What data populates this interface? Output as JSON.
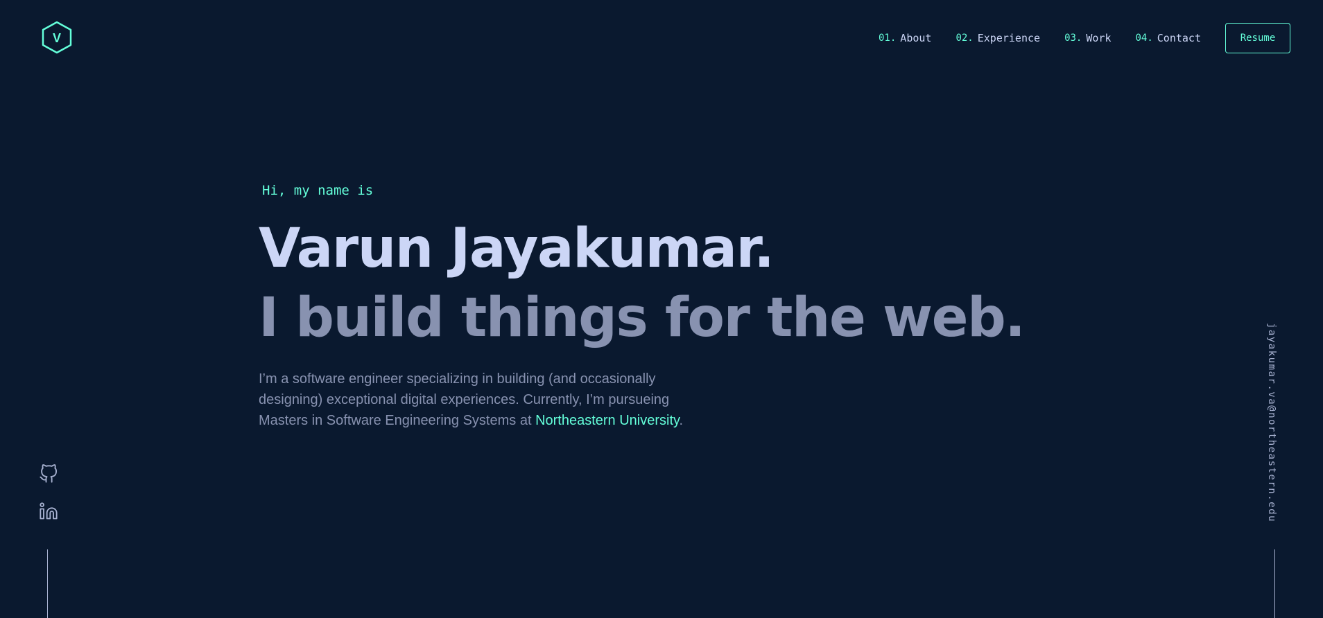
{
  "logo": {
    "letter": "V",
    "icon": "hexagon-logo-icon"
  },
  "nav": {
    "items": [
      {
        "num": "01.",
        "label": "About"
      },
      {
        "num": "02.",
        "label": "Experience"
      },
      {
        "num": "03.",
        "label": "Work"
      },
      {
        "num": "04.",
        "label": "Contact"
      }
    ],
    "resume_label": "Resume"
  },
  "hero": {
    "greeting": "Hi, my name is",
    "name": "Varun Jayakumar.",
    "tagline": "I build things for the web.",
    "intro_text": "I’m a software engineer specializing in building (and occasionally designing) exceptional digital experiences. Currently, I’m pursueing Masters in Software Engineering Systems at ",
    "intro_link": "Northeastern University",
    "intro_end": "."
  },
  "social": {
    "icons": [
      "github-icon",
      "linkedin-icon"
    ]
  },
  "email": "jayakumar.va@northeastern.edu",
  "colors": {
    "background": "#0a192f",
    "accent": "#64ffda",
    "heading": "#ccd6f6",
    "text": "#8892b0",
    "light": "#a8b2d1"
  }
}
